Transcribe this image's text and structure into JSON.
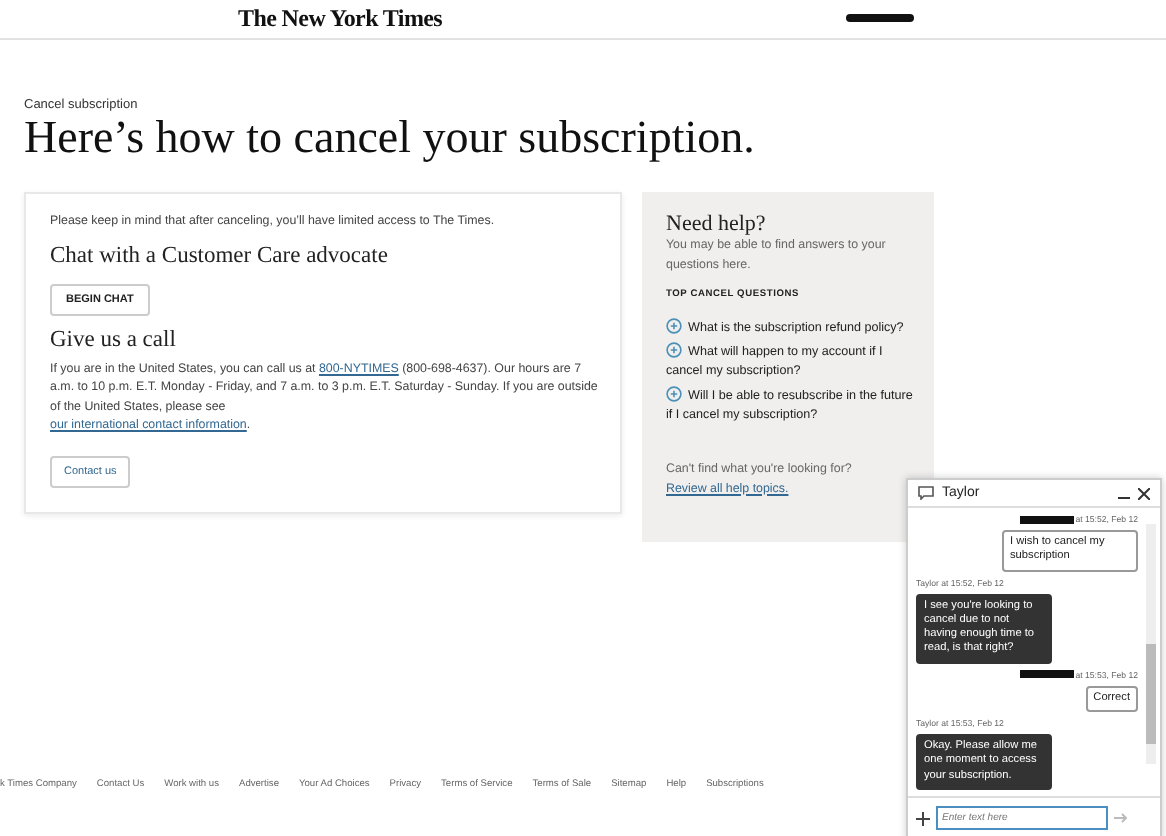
{
  "header": {
    "logo": "The New York Times"
  },
  "breadcrumb": "Cancel subscription",
  "title": "Here’s how to cancel your subscription.",
  "main_card": {
    "notice": "Please keep in mind that after canceling, you’ll have limited access to The Times.",
    "chat_heading": "Chat with a Customer Care advocate",
    "chat_button": "BEGIN CHAT",
    "call_heading": "Give us a call",
    "call_text_before": "If you are in the United States, you can call us at ",
    "phone_link": "800-NYTIMES",
    "call_text_after": " (800-698-4637). Our hours are 7 a.m. to 10 p.m. E.T. Monday - Friday, and 7 a.m. to 3 p.m. E.T. Saturday - Sunday. If you are outside of the United States, please see ",
    "intl_link": "our international contact information",
    "call_text_end": ".",
    "contact_button": "Contact us"
  },
  "help": {
    "title": "Need help?",
    "subtitle": "You may be able to find answers to your questions here.",
    "section": "TOP CANCEL QUESTIONS",
    "questions": [
      "What is the subscription refund policy?",
      "What will happen to my account if I cancel my subscription?",
      "Will I be able to resubscribe in the future if I cancel my subscription?"
    ],
    "footer_text": "Can't find what you're looking for?",
    "footer_link": "Review all help topics."
  },
  "footer": [
    "k Times Company",
    "Contact Us",
    "Work with us",
    "Advertise",
    "Your Ad Choices",
    "Privacy",
    "Terms of Service",
    "Terms of Sale",
    "Sitemap",
    "Help",
    "Subscriptions"
  ],
  "chat": {
    "agent": "Taylor",
    "placeholder": "Enter text here",
    "messages": [
      {
        "kind": "user",
        "meta": "at 15:52, Feb 12",
        "text": "I wish to cancel my subscription"
      },
      {
        "kind": "agent",
        "meta": "Taylor at 15:52, Feb 12",
        "text": "I see you're looking to cancel due to not having enough time to read, is that right?"
      },
      {
        "kind": "user",
        "meta": "at 15:53, Feb 12",
        "text": "Correct"
      },
      {
        "kind": "agent",
        "meta": "Taylor at 15:53, Feb 12",
        "text": "Okay. Please allow me one moment to access your subscription."
      }
    ]
  }
}
